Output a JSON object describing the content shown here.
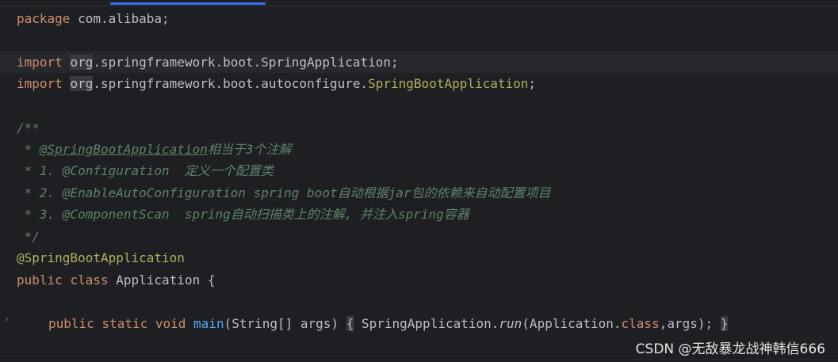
{
  "editor": {
    "line1": {
      "kw": "package",
      "text": " com.alibaba;"
    },
    "line3": {
      "kw": "import",
      "pkg": "org",
      "rest": ".springframework.boot.SpringApplication;"
    },
    "line4": {
      "kw": "import",
      "pkg": "org",
      "rest": ".springframework.boot.autoconfigure.",
      "cls": "SpringBootApplication",
      "end": ";"
    },
    "doc": {
      "open": "/**",
      "l1_prefix": " * ",
      "l1_tag": "@SpringBootApplication",
      "l1_text": "相当于3个注解",
      "l2": " * 1. @Configuration  定义一个配置类",
      "l3": " * 2. @EnableAutoConfiguration spring boot自动根据jar包的依赖来自动配置项目",
      "l4": " * 3. @ComponentScan  spring自动扫描类上的注解, 并注入spring容器",
      "close": " */"
    },
    "annotation": "@SpringBootApplication",
    "class_decl": {
      "kw1": "public",
      "kw2": "class",
      "name": " Application {"
    },
    "main": {
      "kw1": "public",
      "kw2": "static",
      "kw3": "void",
      "name": "main",
      "params": "(String[] args)",
      "open_brace": "{",
      "body_start": " SpringApplication.",
      "method": "run",
      "args_start": "(Application.",
      "class_kw": "class",
      "args_end": ",args);",
      "close_brace": "}"
    }
  },
  "watermark": "CSDN @无敌暴龙战神韩信666"
}
